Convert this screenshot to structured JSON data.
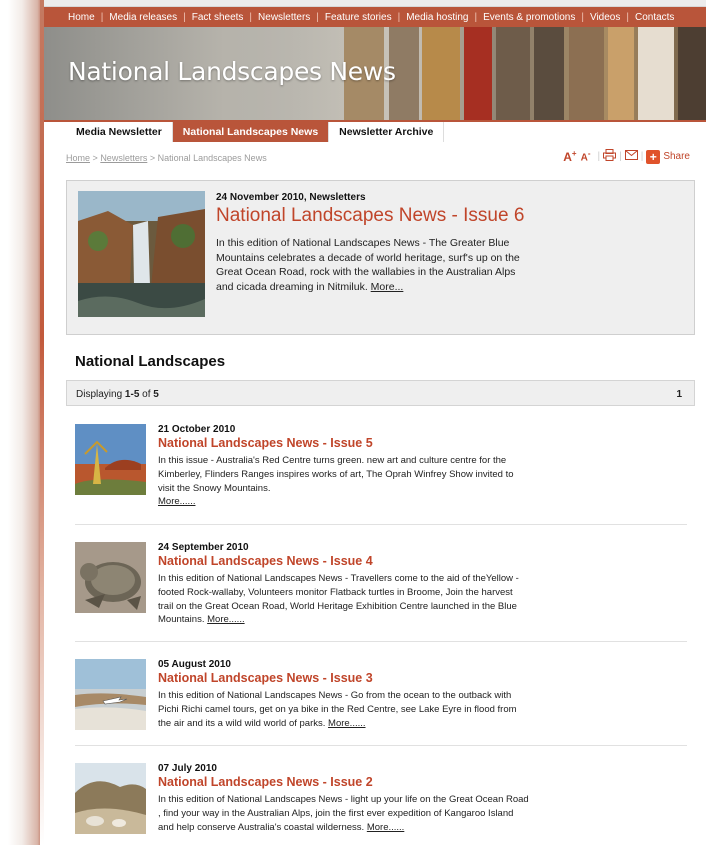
{
  "topnav": [
    "Home",
    "Media releases",
    "Fact sheets",
    "Newsletters",
    "Feature stories",
    "Media hosting",
    "Events & promotions",
    "Videos",
    "Contacts"
  ],
  "banner": {
    "title": "National Landscapes News"
  },
  "subnav": [
    {
      "label": "Media Newsletter",
      "active": false
    },
    {
      "label": "National Landscapes News",
      "active": true
    },
    {
      "label": "Newsletter Archive",
      "active": false
    }
  ],
  "breadcrumb": {
    "home": "Home",
    "sep": ">",
    "newsletters": "Newsletters",
    "current": "National Landscapes News"
  },
  "tools": {
    "increase": "A",
    "decrease": "A",
    "plus_sign": "+",
    "minus_sign": "-",
    "share_label": "Share"
  },
  "featured": {
    "date": "24 November 2010, Newsletters",
    "title": "National Landscapes News - Issue 6",
    "body": "In this edition of National Landscapes News - The Greater Blue Mountains celebrates a decade of world heritage, surf's up on the Great Ocean Road, rock with the wallabies in the Australian Alps and cicada dreaming in Nitmiluk.",
    "more": "More..."
  },
  "section": {
    "heading": "National Landscapes"
  },
  "pager": {
    "prefix": "Displaying ",
    "range": "1-5",
    "of": " of ",
    "total": "5",
    "page": "1"
  },
  "items": [
    {
      "date": "21 October 2010",
      "title": "National Landscapes News - Issue 5",
      "body": "In this issue - Australia's Red Centre turns green. new art and culture centre for the Kimberley, Flinders Ranges inspires works of art, The Oprah Winfrey Show invited to visit the Snowy Mountains.",
      "more": "More......"
    },
    {
      "date": "24 September 2010",
      "title": "National Landscapes News - Issue 4",
      "body": "In this edition of National Landscapes News - Travellers come to the aid of theYellow -footed Rock-wallaby, Volunteers monitor Flatback turtles in Broome, Join the harvest trail on the Great Ocean Road, World Heritage Exhibition Centre launched in the Blue Mountains.",
      "more": "More......"
    },
    {
      "date": "05 August 2010",
      "title": "National Landscapes News - Issue 3",
      "body": "In this edition of National Landscapes News - Go from the ocean to the outback with Pichi Richi camel tours, get on ya bike in the Red Centre, see Lake Eyre in flood from the air and its a wild wild world of parks.",
      "more": "More......"
    },
    {
      "date": "07 July 2010",
      "title": "National Landscapes News - Issue 2",
      "body": "In this edition of National Landscapes News - light up your life on the Great Ocean Road , find your way in the Australian Alps, join the first ever expedition of Kangaroo Island and help conserve Australia's coastal wilderness.",
      "more": "More......"
    }
  ],
  "colors": {
    "brand": "#b9553a",
    "title": "#c0452a",
    "panel": "#efefef"
  }
}
